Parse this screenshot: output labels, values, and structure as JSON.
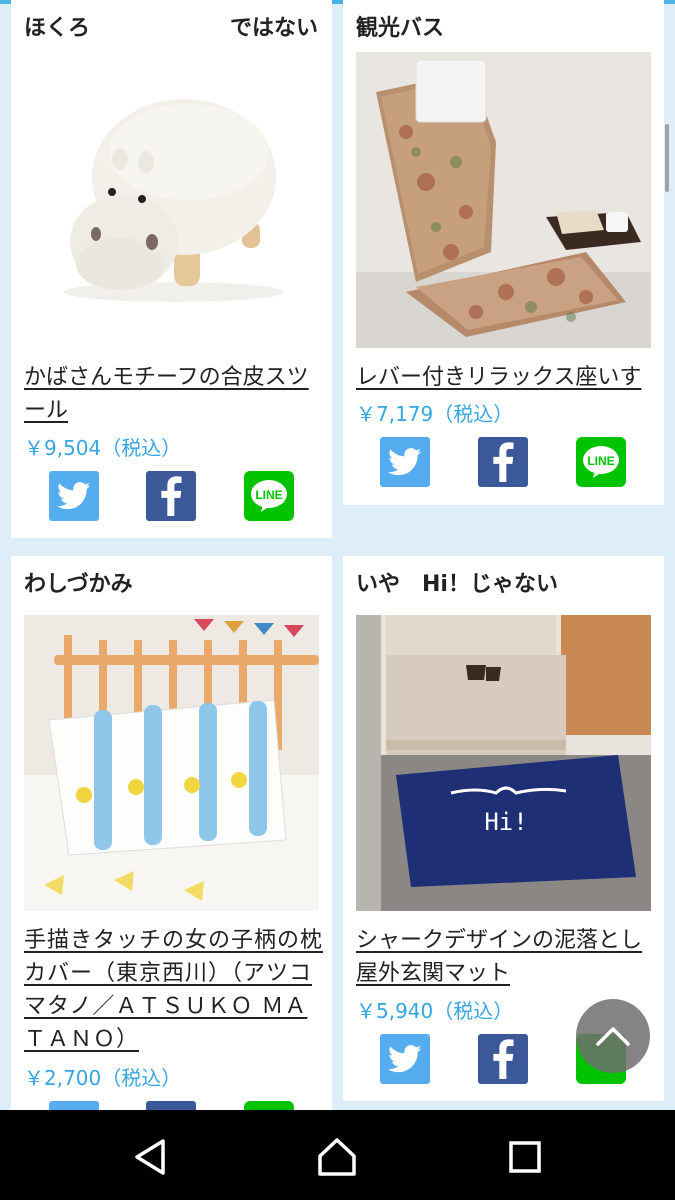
{
  "products": [
    {
      "title": "ほくろ",
      "title_right": "ではない",
      "name": "かばさんモチーフの合皮スツール",
      "price": "￥9,504（税込）"
    },
    {
      "title": "観光バス",
      "name": "レバー付きリラックス座いす",
      "price": "￥7,179（税込）"
    },
    {
      "title": "わしづかみ",
      "name": "手描きタッチの女の子柄の枕カバー（東京西川）（アツコマタノ／ＡＴＳＵＫＯ ＭＡＴＡＮＯ）",
      "price": "￥2,700（税込）"
    },
    {
      "title": "いや　Hi！じゃない",
      "name": "シャークデザインの泥落とし屋外玄関マット",
      "price": "￥5,940（税込）",
      "mat_text": "Hi!"
    }
  ],
  "share": {
    "line_label": "LINE"
  },
  "colors": {
    "price": "#36a6e0",
    "twitter": "#55acee",
    "facebook": "#3b5998",
    "line": "#00c300",
    "background": "#ddeef8"
  },
  "icons": {
    "twitter": "twitter-bird-icon",
    "facebook": "facebook-f-icon",
    "line": "line-icon",
    "back_to_top": "chevron-up-icon",
    "nav_back": "triangle-back-icon",
    "nav_home": "house-icon",
    "nav_recents": "square-recents-icon"
  }
}
